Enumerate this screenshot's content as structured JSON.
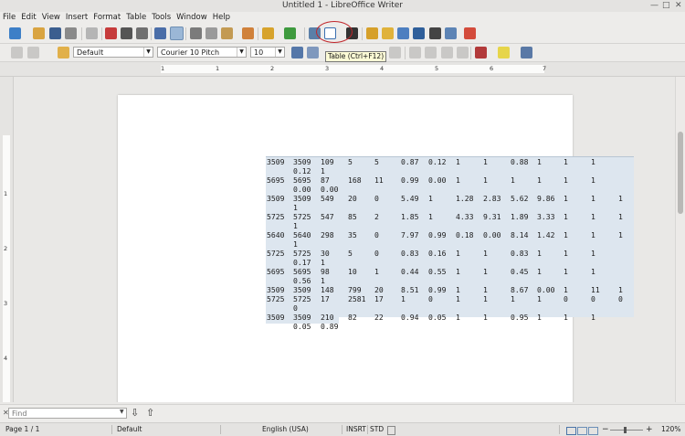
{
  "window": {
    "title": "Untitled 1 - LibreOffice Writer"
  },
  "menu": [
    "File",
    "Edit",
    "View",
    "Insert",
    "Format",
    "Table",
    "Tools",
    "Window",
    "Help"
  ],
  "formatting": {
    "paragraph_style": "Default",
    "font_name": "Courier 10 Pitch",
    "font_size": "10"
  },
  "tooltip": "Table (Ctrl+F12)",
  "ruler": {
    "h_labels": [
      "1",
      "1",
      "2",
      "3",
      "4",
      "5",
      "6",
      "7"
    ],
    "v_labels": [
      "1",
      "2",
      "3",
      "4"
    ]
  },
  "table_rows": [
    [
      "3509",
      "3509",
      "109",
      "5",
      "5",
      "0.87",
      "0.12",
      "1",
      "1",
      "0.88",
      "1",
      "1",
      "1",
      ""
    ],
    [
      "",
      "0.12",
      "1",
      "",
      "",
      "",
      "",
      "",
      "",
      "",
      "",
      "",
      "",
      ""
    ],
    [
      "5695",
      "5695",
      "87",
      "168",
      "11",
      "0.99",
      "0.00",
      "1",
      "1",
      "1",
      "1",
      "1",
      "1",
      ""
    ],
    [
      "",
      "0.00",
      "0.00",
      "",
      "",
      "",
      "",
      "",
      "",
      "",
      "",
      "",
      "",
      ""
    ],
    [
      "3509",
      "3509",
      "549",
      "20",
      "0",
      "5.49",
      "1",
      "1.28",
      "2.83",
      "5.62",
      "9.86",
      "1",
      "1",
      "1"
    ],
    [
      "",
      "1",
      "",
      "",
      "",
      "",
      "",
      "",
      "",
      "",
      "",
      "",
      "",
      ""
    ],
    [
      "5725",
      "5725",
      "547",
      "85",
      "2",
      "1.85",
      "1",
      "4.33",
      "9.31",
      "1.89",
      "3.33",
      "1",
      "1",
      "1"
    ],
    [
      "",
      "1",
      "",
      "",
      "",
      "",
      "",
      "",
      "",
      "",
      "",
      "",
      "",
      ""
    ],
    [
      "5640",
      "5640",
      "298",
      "35",
      "0",
      "7.97",
      "0.99",
      "0.18",
      "0.00",
      "8.14",
      "1.42",
      "1",
      "1",
      "1"
    ],
    [
      "",
      "1",
      "",
      "",
      "",
      "",
      "",
      "",
      "",
      "",
      "",
      "",
      "",
      ""
    ],
    [
      "5725",
      "5725",
      "30",
      "5",
      "0",
      "0.83",
      "0.16",
      "1",
      "1",
      "0.83",
      "1",
      "1",
      "1",
      ""
    ],
    [
      "",
      "0.17",
      "1",
      "",
      "",
      "",
      "",
      "",
      "",
      "",
      "",
      "",
      "",
      ""
    ],
    [
      "5695",
      "5695",
      "98",
      "10",
      "1",
      "0.44",
      "0.55",
      "1",
      "1",
      "0.45",
      "1",
      "1",
      "1",
      ""
    ],
    [
      "",
      "0.56",
      "1",
      "",
      "",
      "",
      "",
      "",
      "",
      "",
      "",
      "",
      "",
      ""
    ],
    [
      "3509",
      "3509",
      "148",
      "799",
      "20",
      "8.51",
      "0.99",
      "1",
      "1",
      "8.67",
      "0.00",
      "1",
      "11",
      "1"
    ],
    [
      "5725",
      "5725",
      "17",
      "2581",
      "17",
      "1",
      "0",
      "1",
      "1",
      "1",
      "1",
      "0",
      "0",
      "0"
    ],
    [
      "",
      "0",
      "",
      "",
      "",
      "",
      "",
      "",
      "",
      "",
      "",
      "",
      "",
      ""
    ],
    [
      "3509",
      "3509",
      "210",
      "82",
      "22",
      "0.94",
      "0.05",
      "1",
      "1",
      "0.95",
      "1",
      "1",
      "1",
      ""
    ],
    [
      "",
      "0.05",
      "0.89",
      "",
      "",
      "",
      "",
      "",
      "",
      "",
      "",
      "",
      "",
      ""
    ]
  ],
  "findbar": {
    "placeholder": "Find"
  },
  "status": {
    "page": "Page 1 / 1",
    "style": "Default",
    "language": "English (USA)",
    "insert_mode": "INSRT",
    "selection_mode": "STD",
    "zoom": "120%"
  },
  "colors": {
    "highlight_circle": "#c0262b",
    "table_selection": "#dde6ef",
    "tooltip_bg": "#fdfbd6"
  }
}
